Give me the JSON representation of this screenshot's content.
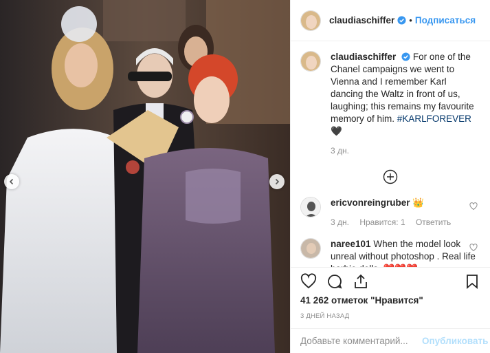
{
  "post": {
    "username": "claudiaschiffer",
    "follow_label": "Подписаться",
    "dot": "•"
  },
  "caption": {
    "username": "claudiaschiffer",
    "text": "For one of the Chanel campaigns we went to Vienna and I remember Karl dancing the Waltz in front of us, laughing; this remains my favourite memory of him.",
    "hashtag": "#KARLFOREVER",
    "emoji": "🖤",
    "time": "3 дн."
  },
  "comments": [
    {
      "username": "ericvonreingruber",
      "text": "",
      "badge": "👑",
      "time": "3 дн.",
      "likes": "Нравится: 1",
      "reply": "Ответить"
    },
    {
      "username": "naree101",
      "text": "When the model look unreal without photoshop . Real life barbie dolls.",
      "hearts": "❤️❤️❤️"
    }
  ],
  "actions": {
    "likes_text": "41 262 отметок \"Нравится\"",
    "date": "3 ДНЕЙ НАЗАД"
  },
  "add_comment": {
    "placeholder": "Добавьте комментарий...",
    "publish_label": "Опубликовать"
  },
  "colors": {
    "accent": "#3897f0",
    "publish_disabled": "#b2dffc",
    "hashtag": "#003569",
    "muted": "#8e8e8e"
  },
  "icons": [
    "verified-badge-icon",
    "load-more-plus-icon",
    "heart-outline-icon",
    "comment-bubble-icon",
    "share-arrow-icon",
    "bookmark-icon",
    "chevron-left-icon",
    "chevron-right-icon"
  ]
}
